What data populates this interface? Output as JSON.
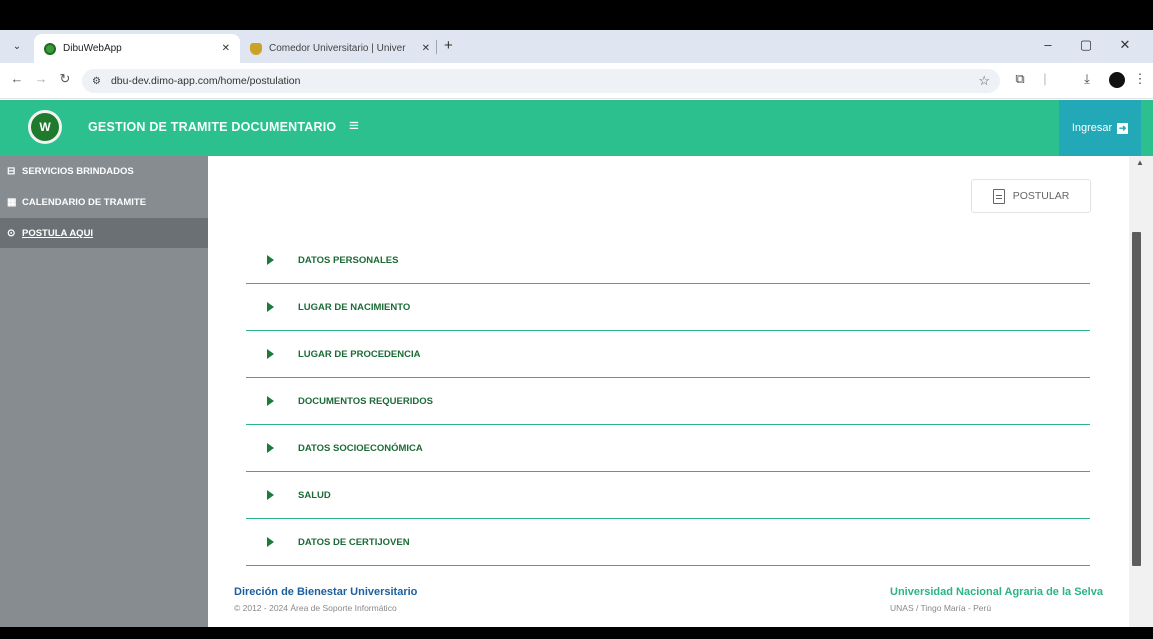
{
  "browser": {
    "tabs": [
      {
        "title": "DibuWebApp",
        "active": true
      },
      {
        "title": "Comedor Universitario | Univer",
        "active": false
      }
    ],
    "url": "dbu-dev.dimo-app.com/home/postulation",
    "window_controls": {
      "minimize": "–",
      "restore": "▢",
      "close": "✕"
    }
  },
  "header": {
    "title": "GESTION DE TRAMITE DOCUMENTARIO",
    "login_label": "Ingresar",
    "color": "#2cc08e",
    "login_color": "#23a8b7"
  },
  "sidebar": {
    "items": [
      {
        "label": "SERVICIOS BRINDADOS",
        "icon": "briefcase-icon",
        "active": false
      },
      {
        "label": "CALENDARIO DE TRAMITE",
        "icon": "calendar-icon",
        "active": false
      },
      {
        "label": "POSTULA AQUI",
        "icon": "link-icon",
        "active": true
      }
    ]
  },
  "main": {
    "postular_label": "POSTULAR",
    "sections": [
      "DATOS PERSONALES",
      "LUGAR DE NACIMIENTO",
      "LUGAR DE PROCEDENCIA",
      "DOCUMENTOS REQUERIDOS",
      "DATOS SOCIOECONÓMICA",
      "SALUD",
      "DATOS DE CERTIJOVEN"
    ]
  },
  "footer": {
    "left_title": "Direción de Bienestar Universitario",
    "left_sub": "© 2012 - 2024 Área de Soporte Informático",
    "right_title": "Universidad Nacional Agraria de la Selva",
    "right_sub": "UNAS / Tingo María - Perú"
  }
}
